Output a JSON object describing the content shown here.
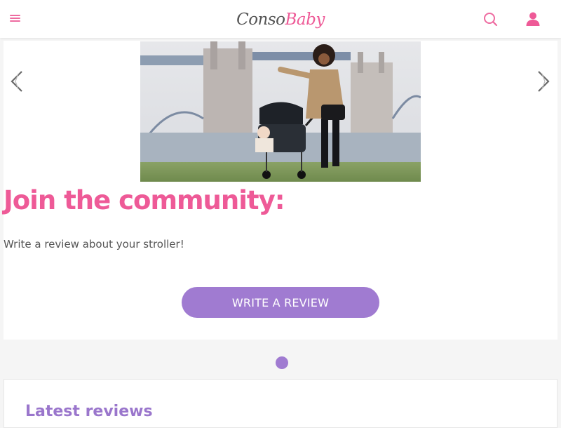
{
  "header": {
    "logo_part1": "Conso",
    "logo_part2": "Baby",
    "brand_color": "#ee5a97",
    "icons": [
      "menu-icon",
      "search-icon",
      "user-icon"
    ]
  },
  "hero": {
    "image_alt": "",
    "title": "Join the community:",
    "subtitle": "Write a review about your stroller!",
    "cta_label": "WRITE A REVIEW",
    "accent_color": "#a07bd1"
  },
  "carousel": {
    "prev_icon": "chevron-left-icon",
    "next_icon": "chevron-right-icon",
    "slide_count": 1,
    "active_index": 0
  },
  "latest": {
    "title": "Latest reviews"
  }
}
